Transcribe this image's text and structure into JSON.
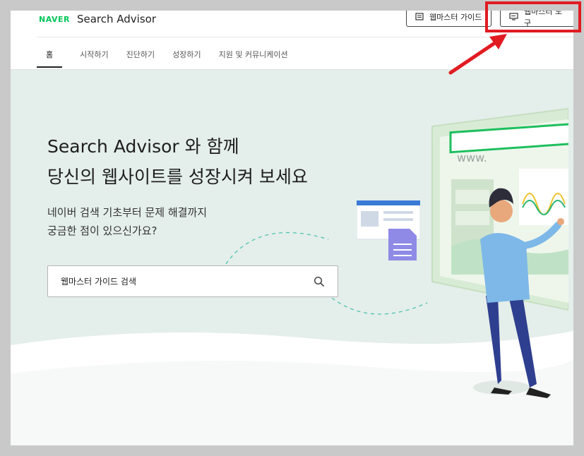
{
  "header": {
    "logo": "NAVER",
    "title": "Search Advisor",
    "guide_button": "웹마스터 가이드",
    "tools_button": "웹마스터 도구"
  },
  "nav": {
    "items": [
      "홈",
      "시작하기",
      "진단하기",
      "성장하기",
      "지원 및 커뮤니케이션"
    ],
    "active": "홈"
  },
  "hero": {
    "title_line1": "Search Advisor 와 함께",
    "title_line2": "당신의 웹사이트를 성장시켜 보세요",
    "subtitle_line1": "네이버 검색 기초부터 문제 해결까지",
    "subtitle_line2": "궁금한 점이 있으신가요?",
    "search_placeholder": "웹마스터 가이드 검색",
    "illustration_url_text": "www."
  },
  "colors": {
    "naver_green": "#03c75a",
    "hero_bg": "#e4eeea",
    "highlight_red": "#e11b22"
  },
  "icons": {
    "guide": "book-icon",
    "tools": "monitor-icon",
    "search": "search-icon"
  }
}
